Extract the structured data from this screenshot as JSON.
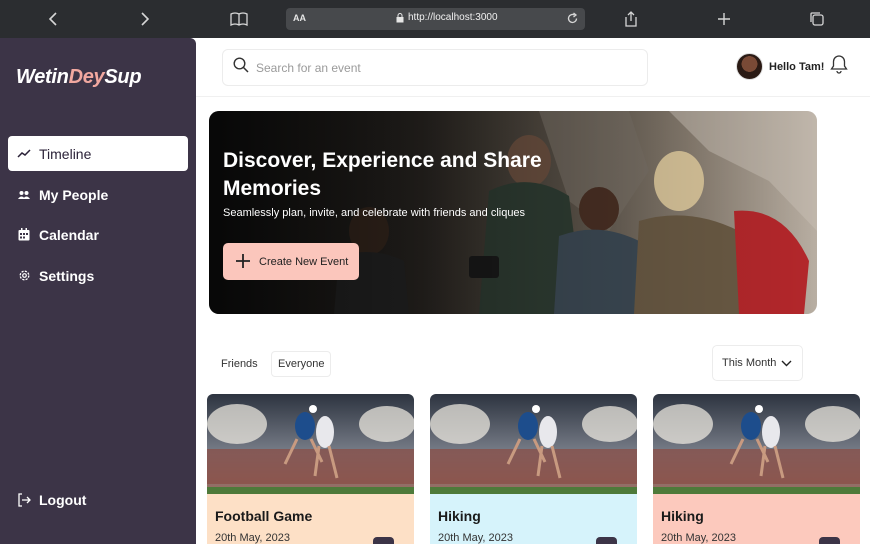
{
  "browser": {
    "aa_label": "AA",
    "url": "http://localhost:3000"
  },
  "sidebar": {
    "logo_part1": "Wetin",
    "logo_part2": "Dey",
    "logo_part3": "Sup",
    "items": [
      {
        "label": "Timeline",
        "icon": "trend-icon"
      },
      {
        "label": "My People",
        "icon": "people-icon"
      },
      {
        "label": "Calendar",
        "icon": "calendar-icon"
      },
      {
        "label": "Settings",
        "icon": "gear-icon"
      }
    ],
    "logout_label": "Logout"
  },
  "header": {
    "search_placeholder": "Search for an event",
    "greeting": "Hello Tam!"
  },
  "hero": {
    "title": "Discover, Experience and Share Memories",
    "subtitle": "Seamlessly plan, invite, and celebrate with friends and cliques",
    "button_label": "Create New Event"
  },
  "filters": {
    "friends": "Friends",
    "everyone": "Everyone",
    "period": "This Month"
  },
  "events": [
    {
      "title": "Football Game",
      "date": "20th May, 2023",
      "color": "#fde0c6"
    },
    {
      "title": "Hiking",
      "date": "20th May, 2023",
      "color": "#d6f3fb"
    },
    {
      "title": "Hiking",
      "date": "20th May, 2023",
      "color": "#fcc9bd"
    }
  ],
  "colors": {
    "sidebar": "#3c3447",
    "accent": "#f2a8a0",
    "button": "#fbc6bc"
  }
}
